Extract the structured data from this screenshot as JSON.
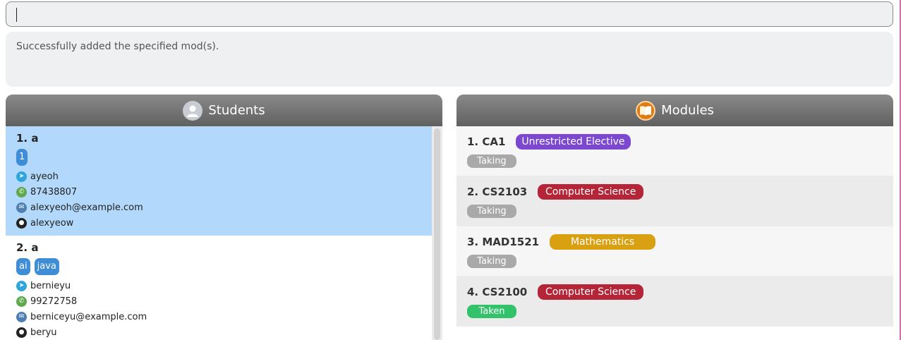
{
  "command": {
    "value": "",
    "placeholder": ""
  },
  "result": {
    "message": "Successfully added the specified mod(s)."
  },
  "students_panel": {
    "title": "Students",
    "items": [
      {
        "title": "1. a",
        "tags": [
          "1"
        ],
        "telegram": "ayeoh",
        "phone": "87438807",
        "email": "alexyeoh@example.com",
        "github": "alexyeow"
      },
      {
        "title": "2. a",
        "tags": [
          "ai",
          "java"
        ],
        "telegram": "bernieyu",
        "phone": "99272758",
        "email": "berniceyu@example.com",
        "github": "beryu"
      }
    ]
  },
  "modules_panel": {
    "title": "Modules",
    "items": [
      {
        "title": "1. CA1",
        "category": "Unrestricted Elective",
        "category_color": "#7c48cf",
        "status": "Taking",
        "status_color": "#a9a9a9"
      },
      {
        "title": "2. CS2103",
        "category": "Computer Science",
        "category_color": "#b52538",
        "status": "Taking",
        "status_color": "#a9a9a9"
      },
      {
        "title": "3. MAD1521",
        "category": "Mathematics",
        "category_color": "#d9a012",
        "status": "Taking",
        "status_color": "#a9a9a9"
      },
      {
        "title": "4. CS2100",
        "category": "Computer Science",
        "category_color": "#b52538",
        "status": "Taken",
        "status_color": "#31c26a"
      }
    ]
  }
}
